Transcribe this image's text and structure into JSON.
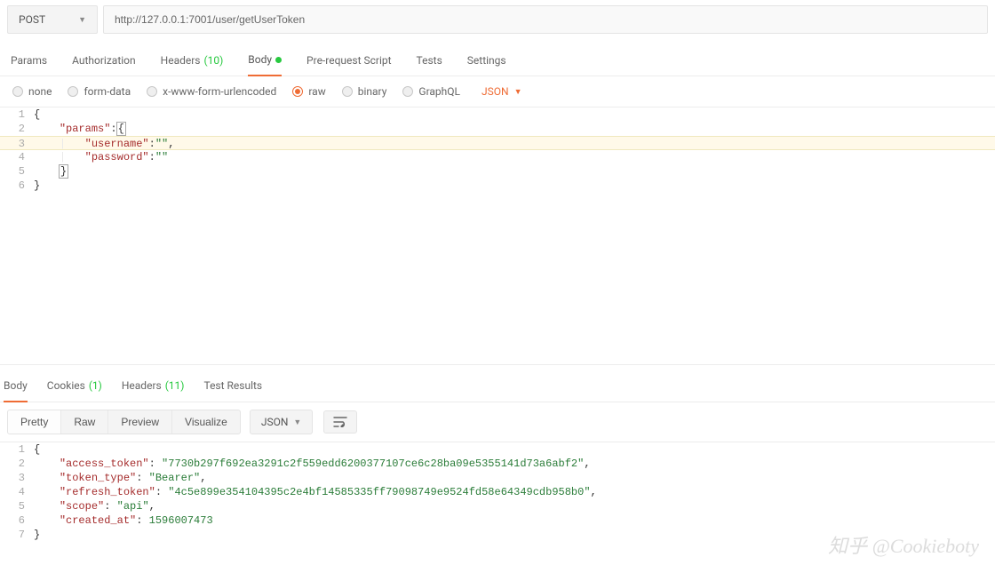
{
  "request": {
    "method": "POST",
    "url": "http://127.0.0.1:7001/user/getUserToken"
  },
  "tabs": {
    "params": "Params",
    "authorization": "Authorization",
    "headers_label": "Headers",
    "headers_count": "(10)",
    "body": "Body",
    "prerequest": "Pre-request Script",
    "tests": "Tests",
    "settings": "Settings"
  },
  "body_types": {
    "none": "none",
    "formdata": "form-data",
    "xwww": "x-www-form-urlencoded",
    "raw": "raw",
    "binary": "binary",
    "graphql": "GraphQL",
    "format": "JSON"
  },
  "editor_lines": [
    "1",
    "2",
    "3",
    "4",
    "5",
    "6"
  ],
  "editor_tokens": {
    "params": "\"params\"",
    "username": "\"username\"",
    "password": "\"password\"",
    "empty": "\"\""
  },
  "resp_tabs": {
    "body": "Body",
    "cookies_label": "Cookies",
    "cookies_count": "(1)",
    "headers_label": "Headers",
    "headers_count": "(11)",
    "test_results": "Test Results"
  },
  "resp_toolbar": {
    "pretty": "Pretty",
    "raw": "Raw",
    "preview": "Preview",
    "visualize": "Visualize",
    "format": "JSON"
  },
  "resp_lines": [
    "1",
    "2",
    "3",
    "4",
    "5",
    "6",
    "7"
  ],
  "resp_tokens": {
    "access_token_k": "\"access_token\"",
    "access_token_v": "\"7730b297f692ea3291c2f559edd6200377107ce6c28ba09e5355141d73a6abf2\"",
    "token_type_k": "\"token_type\"",
    "token_type_v": "\"Bearer\"",
    "refresh_token_k": "\"refresh_token\"",
    "refresh_token_v": "\"4c5e899e354104395c2e4bf14585335ff79098749e9524fd58e64349cdb958b0\"",
    "scope_k": "\"scope\"",
    "scope_v": "\"api\"",
    "created_at_k": "\"created_at\"",
    "created_at_v": "1596007473"
  },
  "watermark": "知乎 @Cookieboty"
}
